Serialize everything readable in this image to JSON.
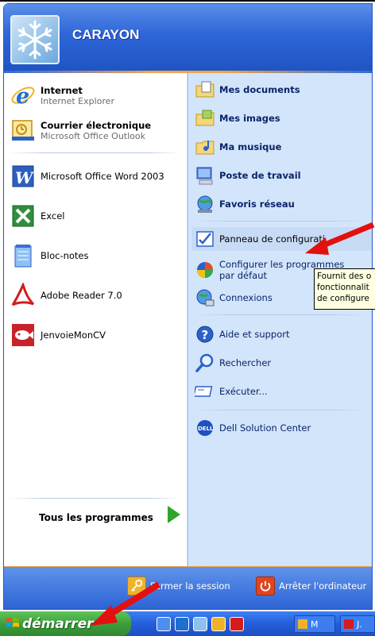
{
  "user": {
    "name": "CARAYON"
  },
  "pinned": [
    {
      "title": "Internet",
      "subtitle": "Internet Explorer"
    },
    {
      "title": "Courrier électronique",
      "subtitle": "Microsoft Office Outlook"
    }
  ],
  "recent": [
    {
      "label": "Microsoft Office Word 2003"
    },
    {
      "label": "Excel"
    },
    {
      "label": "Bloc-notes"
    },
    {
      "label": "Adobe Reader 7.0"
    },
    {
      "label": "JenvoieMonCV"
    }
  ],
  "all_programs": "Tous les programmes",
  "places": [
    {
      "label": "Mes documents"
    },
    {
      "label": "Mes images"
    },
    {
      "label": "Ma musique"
    },
    {
      "label": "Poste de travail"
    },
    {
      "label": "Favoris réseau"
    }
  ],
  "system": [
    {
      "label": "Panneau de configurati"
    },
    {
      "label1": "Configurer les programmes",
      "label2": "par défaut"
    },
    {
      "label": "Connexions"
    }
  ],
  "tools": [
    {
      "label": "Aide et support"
    },
    {
      "label": "Rechercher"
    },
    {
      "label": "Exécuter..."
    }
  ],
  "oem": {
    "label": "Dell Solution Center"
  },
  "tooltip": {
    "line1": "Fournit des o",
    "line2": "fonctionnalit",
    "line3": "de configure"
  },
  "footer": {
    "logoff": "Fermer la session",
    "shutdown": "Arrêter l'ordinateur"
  },
  "taskbar": {
    "start": "démarrer",
    "btn1": "M",
    "btn2": "J."
  },
  "colors": {
    "accent": "#2356c9",
    "start_green": "#3b9b3a",
    "arrow_red": "#e31010"
  }
}
